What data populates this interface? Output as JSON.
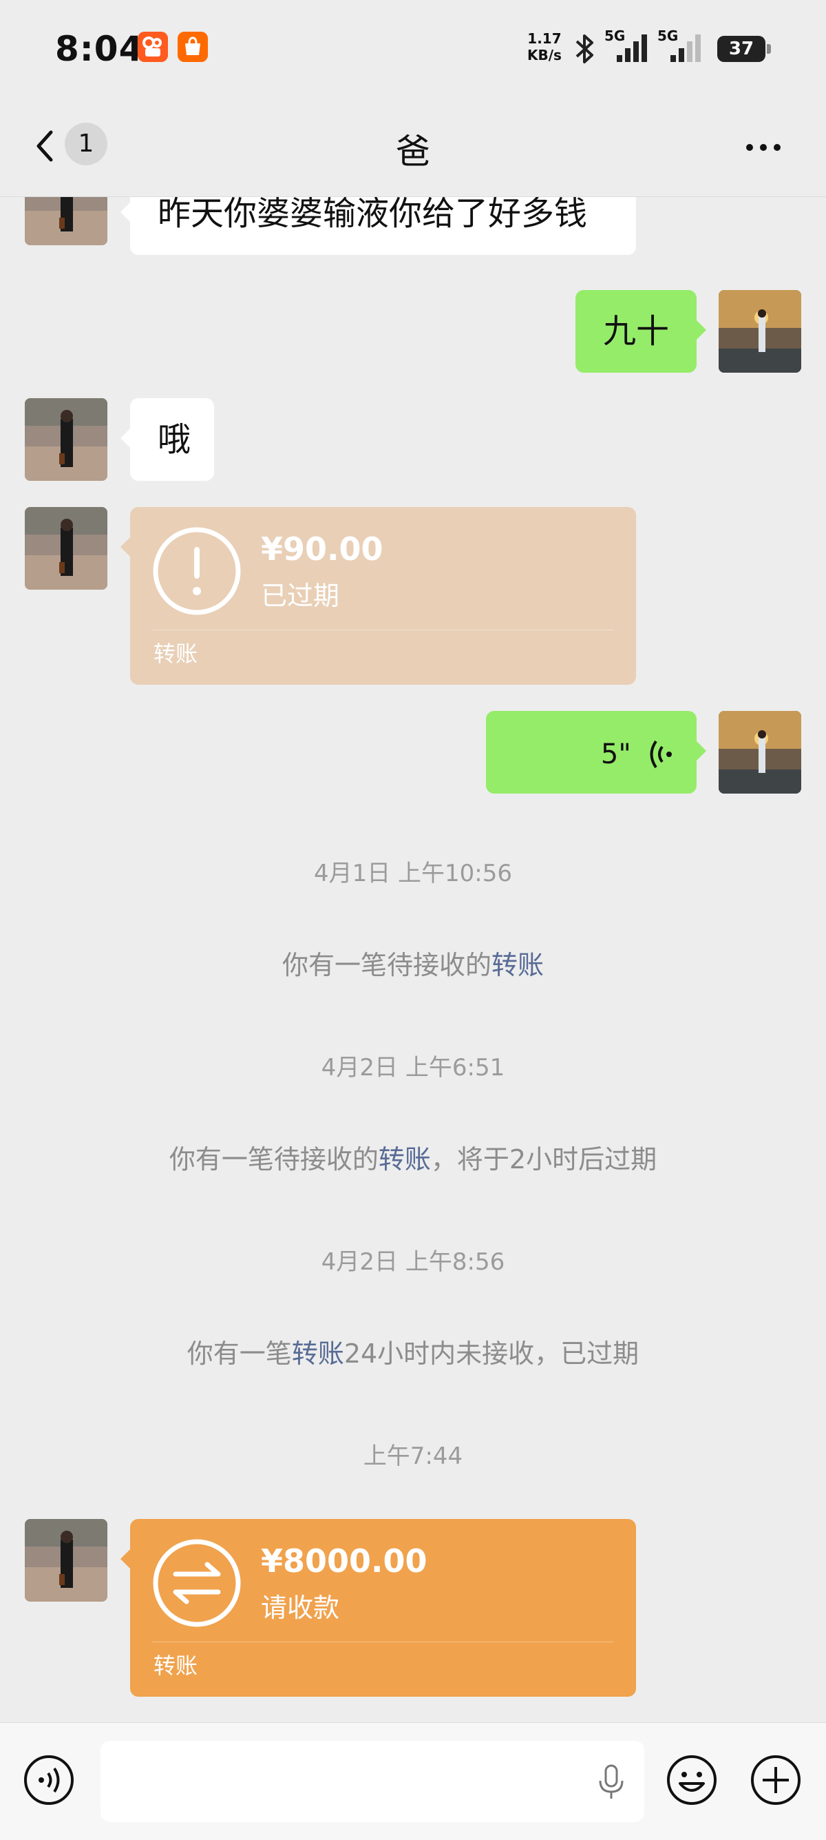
{
  "status_bar": {
    "time": "8:04",
    "app_badges": [
      "快手",
      "淘宝"
    ],
    "net_speed_value": "1.17",
    "net_speed_unit": "KB/s",
    "network_1": "5G",
    "network_2": "5G",
    "battery": "37"
  },
  "header": {
    "unread_count": "1",
    "title": "爸"
  },
  "messages": {
    "m1_text": "昨天你婆婆输液你给了好多钱",
    "m2_text": "九十",
    "m3_text": "哦",
    "transfer1": {
      "amount": "¥90.00",
      "status": "已过期",
      "label": "转账"
    },
    "voice": {
      "duration": "5\""
    },
    "ts1": "4月1日 上午10:56",
    "sys1_a": "你有一笔待接收的",
    "sys1_link": "转账",
    "ts2": "4月2日 上午6:51",
    "sys2_a": "你有一笔待接收的",
    "sys2_link": "转账",
    "sys2_b": "，将于2小时后过期",
    "ts3": "4月2日 上午8:56",
    "sys3_a": "你有一笔",
    "sys3_link": "转账",
    "sys3_b": "24小时内未接收，已过期",
    "ts4": "上午7:44",
    "transfer2": {
      "amount": "¥8000.00",
      "status": "请收款",
      "label": "转账"
    }
  },
  "icons": {
    "back": "chevron-left-icon",
    "more": "more-icon",
    "voice_toggle": "voice-mode-icon",
    "mic": "microphone-icon",
    "emoji": "emoji-icon",
    "plus": "plus-icon"
  },
  "colors": {
    "sent_bubble": "#95ec69",
    "expired_transfer": "#e8cfb6",
    "pending_transfer": "#f0a24d",
    "link": "#576b95"
  }
}
